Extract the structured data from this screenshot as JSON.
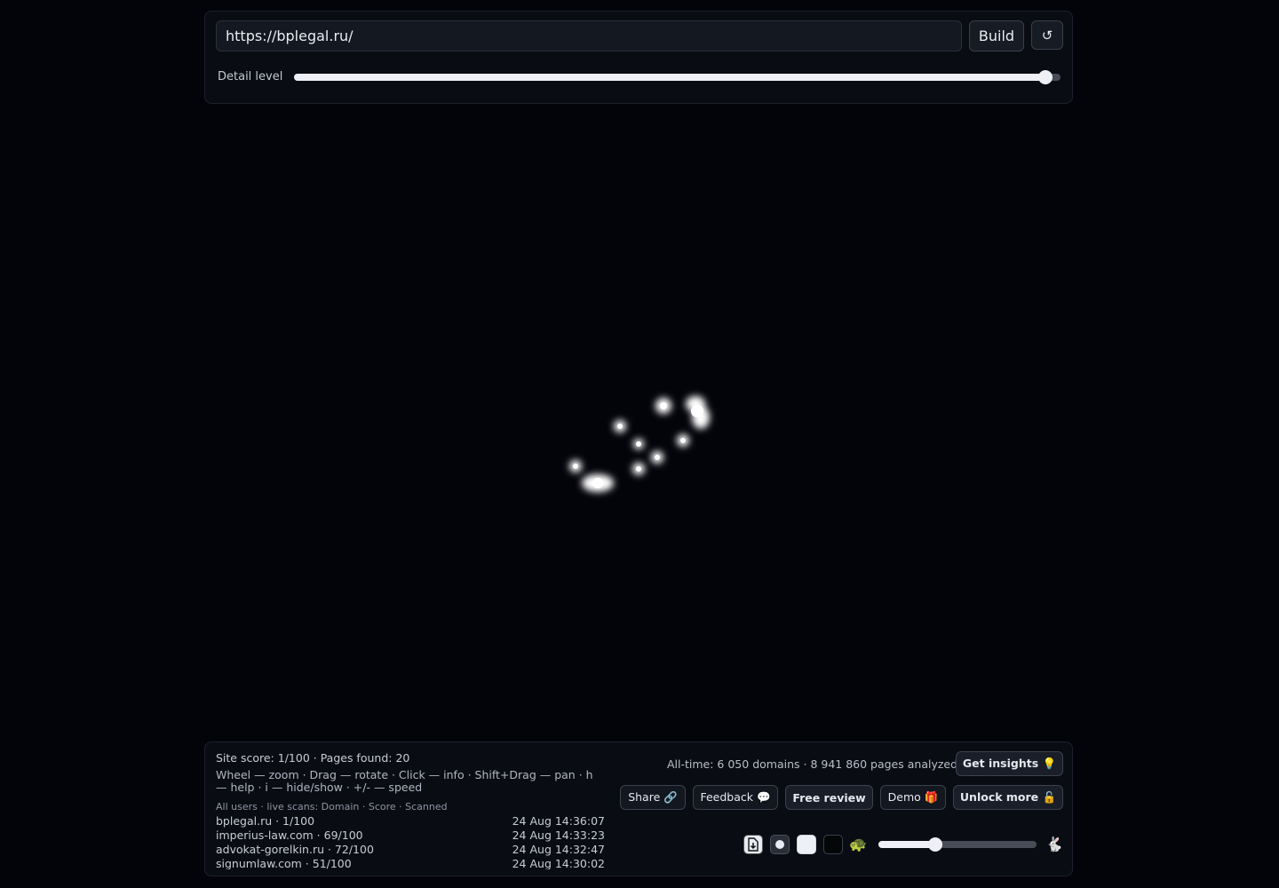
{
  "toolbar": {
    "url_value": "https://bplegal.ru/",
    "build_label": "Build",
    "reset_icon_glyph": "↺",
    "detail_label": "Detail level",
    "detail_level_fraction": 0.98
  },
  "stats": {
    "site_score": "Site score: 1/100 · Pages found: 20",
    "help_text": "Wheel — zoom · Drag — rotate · Click — info · Shift+Drag — pan · h — help · i — hide/show · +/- — speed",
    "scans_header": "All users · live scans: Domain · Score · Scanned",
    "scans": [
      {
        "domain": "bplegal.ru · 1/100",
        "time": "24 Aug 14:36:07"
      },
      {
        "domain": "imperius-law.com · 69/100",
        "time": "24 Aug 14:33:23"
      },
      {
        "domain": "advokat-gorelkin.ru · 72/100",
        "time": "24 Aug 14:32:47"
      },
      {
        "domain": "signumlaw.com · 51/100",
        "time": "24 Aug 14:30:02"
      }
    ],
    "alltime": "All-time: 6 050 domains · 8 941 860 pages analyzed"
  },
  "actions": {
    "get_insights": "Get insights 💡",
    "share": "Share 🔗",
    "feedback": "Feedback 💬",
    "free_review": "Free review",
    "demo": "Demo 🎁",
    "unlock_more": "Unlock more 🔓"
  },
  "controls": {
    "turtle_glyph": "🐢",
    "rabbit_glyph": "🐇",
    "speed_fraction": 0.36
  },
  "colors": {
    "background": "#03040a",
    "node": "#ffffff"
  }
}
